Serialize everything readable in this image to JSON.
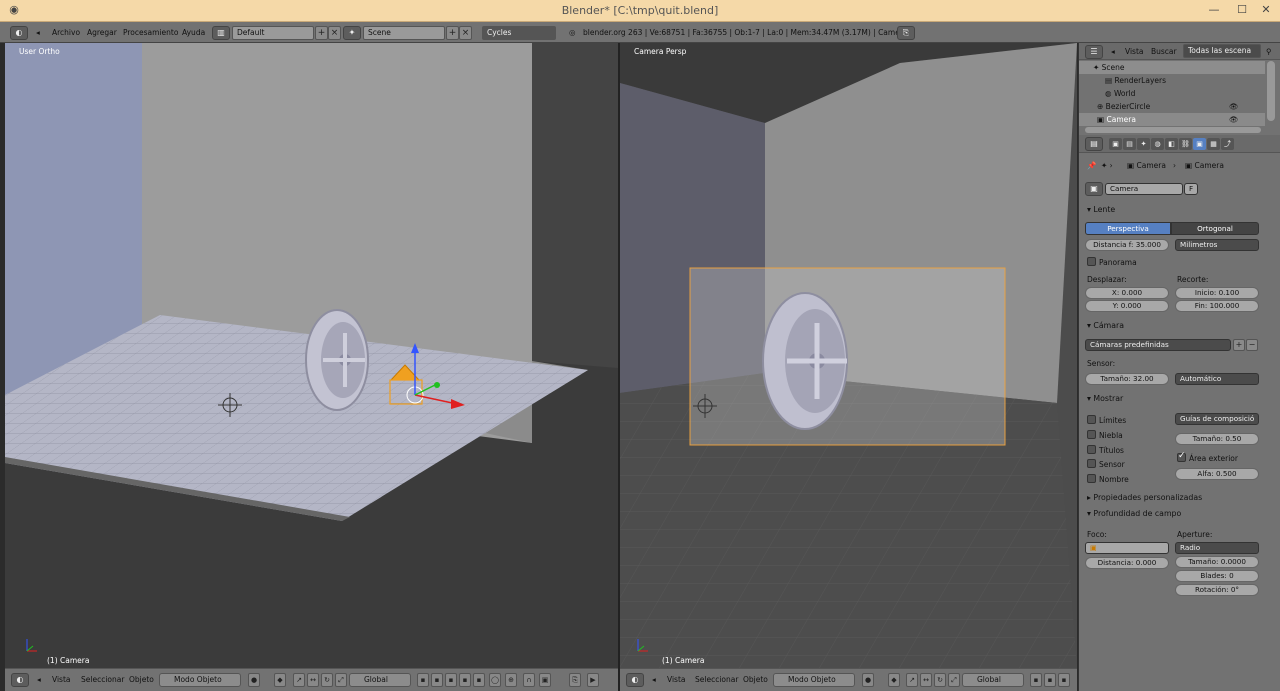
{
  "window": {
    "title": "Blender* [C:\\tmp\\quit.blend]"
  },
  "menu": {
    "archivo": "Archivo",
    "agregar": "Agregar",
    "procesamiento": "Procesamiento",
    "ayuda": "Ayuda",
    "layout": "Default",
    "scene": "Scene",
    "engine": "Cycles",
    "stats": "blender.org 263 | Ve:68751 | Fa:36755 | Ob:1-7 | La:0 | Mem:34.47M (3.17M) | Camera"
  },
  "viewport_left": {
    "label": "User Ortho",
    "object": "(1) Camera"
  },
  "viewport_right": {
    "label": "Camera Persp",
    "object": "(1) Camera"
  },
  "header": {
    "vista": "Vista",
    "seleccionar": "Seleccionar",
    "objeto": "Objeto",
    "mode": "Modo Objeto",
    "orientation": "Global"
  },
  "outliner": {
    "vista": "Vista",
    "buscar": "Buscar",
    "filter": "Todas las escena",
    "items": [
      "Scene",
      "RenderLayers",
      "World",
      "BezierCircle",
      "Camera"
    ]
  },
  "properties": {
    "breadcrumb_obj": "Camera",
    "breadcrumb_data": "Camera",
    "datablock": "Camera",
    "fake_user": "F",
    "lente": {
      "title": "Lente",
      "perspectiva": "Perspectiva",
      "ortogonal": "Ortogonal",
      "distancia": "Distancia f: 35.000",
      "unit": "Milimetros",
      "panorama": "Panorama",
      "desplazar": "Desplazar:",
      "x": "X: 0.000",
      "y": "Y: 0.000",
      "recorte": "Recorte:",
      "inicio": "Inicio: 0.100",
      "fin": "Fin: 100.000"
    },
    "camara": {
      "title": "Cámara",
      "preset": "Cámaras predefinidas",
      "sensor": "Sensor:",
      "tamano": "Tamaño: 32.00",
      "fit": "Automático"
    },
    "mostrar": {
      "title": "Mostrar",
      "limites": "Límites",
      "niebla": "Niebla",
      "titulos": "Títulos",
      "sensor": "Sensor",
      "nombre": "Nombre",
      "guides": "Guías de composició",
      "guide_size": "Tamaño: 0.50",
      "area_exterior": "Área exterior",
      "alfa": "Alfa: 0.500"
    },
    "custom_props": "Propiedades personalizadas",
    "dof": {
      "title": "Profundidad de campo",
      "foco": "Foco:",
      "distancia": "Distancia: 0.000",
      "aperture": "Aperture:",
      "type": "Radio",
      "tamano": "Tamaño: 0.0000",
      "blades": "Blades: 0",
      "rotacion": "Rotación: 0°"
    }
  }
}
